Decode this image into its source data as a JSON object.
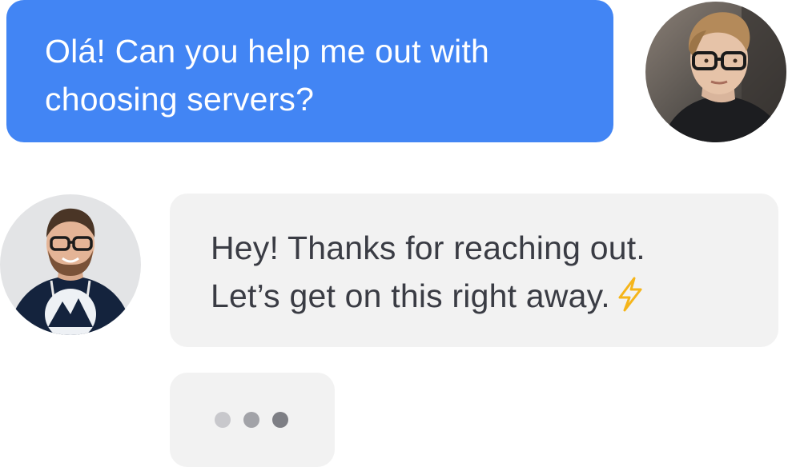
{
  "messages": {
    "user": {
      "line1": "Olá! Can you help me out with",
      "line2": "choosing servers?"
    },
    "agent": {
      "line1": "Hey! Thanks for reaching out.",
      "line2": "Let’s get on this right away."
    }
  },
  "icons": {
    "agent_emoji": "lightning-icon",
    "typing": "typing-indicator"
  },
  "colors": {
    "user_bubble": "#4285f4",
    "agent_bubble": "#f2f2f2",
    "agent_text": "#3a3c44",
    "bolt": "#f5b51a"
  }
}
